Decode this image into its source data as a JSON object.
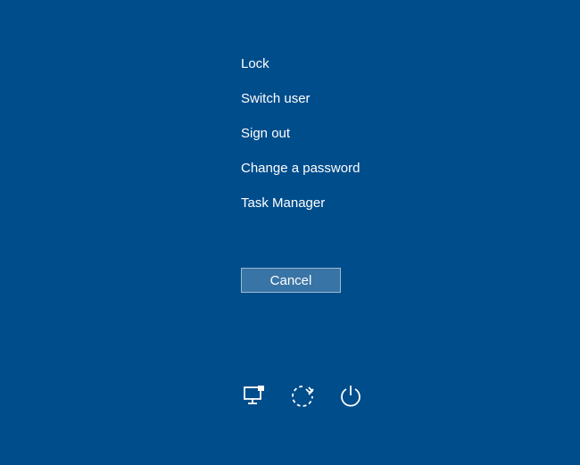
{
  "menu": {
    "items": [
      {
        "label": "Lock"
      },
      {
        "label": "Switch user"
      },
      {
        "label": "Sign out"
      },
      {
        "label": "Change a password"
      },
      {
        "label": "Task Manager"
      }
    ]
  },
  "cancel_label": "Cancel",
  "icons": {
    "network": "network-icon",
    "ease_of_access": "ease-of-access-icon",
    "power": "power-icon"
  }
}
